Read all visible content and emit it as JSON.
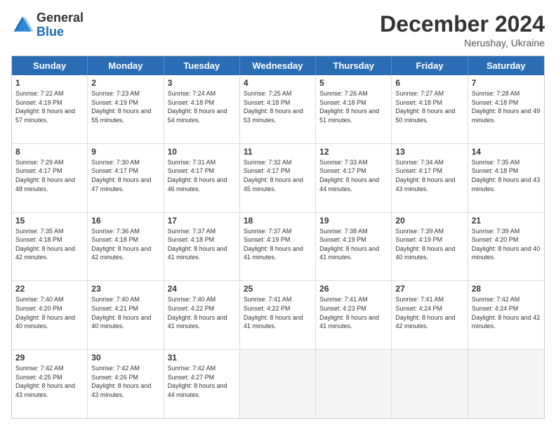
{
  "header": {
    "logo_general": "General",
    "logo_blue": "Blue",
    "month_title": "December 2024",
    "subtitle": "Nerushay, Ukraine"
  },
  "days_of_week": [
    "Sunday",
    "Monday",
    "Tuesday",
    "Wednesday",
    "Thursday",
    "Friday",
    "Saturday"
  ],
  "weeks": [
    [
      {
        "num": "1",
        "sunrise": "7:22 AM",
        "sunset": "4:19 PM",
        "daylight": "8 hours and 57 minutes."
      },
      {
        "num": "2",
        "sunrise": "7:23 AM",
        "sunset": "4:19 PM",
        "daylight": "8 hours and 55 minutes."
      },
      {
        "num": "3",
        "sunrise": "7:24 AM",
        "sunset": "4:18 PM",
        "daylight": "8 hours and 54 minutes."
      },
      {
        "num": "4",
        "sunrise": "7:25 AM",
        "sunset": "4:18 PM",
        "daylight": "8 hours and 53 minutes."
      },
      {
        "num": "5",
        "sunrise": "7:26 AM",
        "sunset": "4:18 PM",
        "daylight": "8 hours and 51 minutes."
      },
      {
        "num": "6",
        "sunrise": "7:27 AM",
        "sunset": "4:18 PM",
        "daylight": "8 hours and 50 minutes."
      },
      {
        "num": "7",
        "sunrise": "7:28 AM",
        "sunset": "4:18 PM",
        "daylight": "8 hours and 49 minutes."
      }
    ],
    [
      {
        "num": "8",
        "sunrise": "7:29 AM",
        "sunset": "4:17 PM",
        "daylight": "8 hours and 48 minutes."
      },
      {
        "num": "9",
        "sunrise": "7:30 AM",
        "sunset": "4:17 PM",
        "daylight": "8 hours and 47 minutes."
      },
      {
        "num": "10",
        "sunrise": "7:31 AM",
        "sunset": "4:17 PM",
        "daylight": "8 hours and 46 minutes."
      },
      {
        "num": "11",
        "sunrise": "7:32 AM",
        "sunset": "4:17 PM",
        "daylight": "8 hours and 45 minutes."
      },
      {
        "num": "12",
        "sunrise": "7:33 AM",
        "sunset": "4:17 PM",
        "daylight": "8 hours and 44 minutes."
      },
      {
        "num": "13",
        "sunrise": "7:34 AM",
        "sunset": "4:17 PM",
        "daylight": "8 hours and 43 minutes."
      },
      {
        "num": "14",
        "sunrise": "7:35 AM",
        "sunset": "4:18 PM",
        "daylight": "8 hours and 43 minutes."
      }
    ],
    [
      {
        "num": "15",
        "sunrise": "7:35 AM",
        "sunset": "4:18 PM",
        "daylight": "8 hours and 42 minutes."
      },
      {
        "num": "16",
        "sunrise": "7:36 AM",
        "sunset": "4:18 PM",
        "daylight": "8 hours and 42 minutes."
      },
      {
        "num": "17",
        "sunrise": "7:37 AM",
        "sunset": "4:18 PM",
        "daylight": "8 hours and 41 minutes."
      },
      {
        "num": "18",
        "sunrise": "7:37 AM",
        "sunset": "4:19 PM",
        "daylight": "8 hours and 41 minutes."
      },
      {
        "num": "19",
        "sunrise": "7:38 AM",
        "sunset": "4:19 PM",
        "daylight": "8 hours and 41 minutes."
      },
      {
        "num": "20",
        "sunrise": "7:39 AM",
        "sunset": "4:19 PM",
        "daylight": "8 hours and 40 minutes."
      },
      {
        "num": "21",
        "sunrise": "7:39 AM",
        "sunset": "4:20 PM",
        "daylight": "8 hours and 40 minutes."
      }
    ],
    [
      {
        "num": "22",
        "sunrise": "7:40 AM",
        "sunset": "4:20 PM",
        "daylight": "8 hours and 40 minutes."
      },
      {
        "num": "23",
        "sunrise": "7:40 AM",
        "sunset": "4:21 PM",
        "daylight": "8 hours and 40 minutes."
      },
      {
        "num": "24",
        "sunrise": "7:40 AM",
        "sunset": "4:22 PM",
        "daylight": "8 hours and 41 minutes."
      },
      {
        "num": "25",
        "sunrise": "7:41 AM",
        "sunset": "4:22 PM",
        "daylight": "8 hours and 41 minutes."
      },
      {
        "num": "26",
        "sunrise": "7:41 AM",
        "sunset": "4:23 PM",
        "daylight": "8 hours and 41 minutes."
      },
      {
        "num": "27",
        "sunrise": "7:41 AM",
        "sunset": "4:24 PM",
        "daylight": "8 hours and 42 minutes."
      },
      {
        "num": "28",
        "sunrise": "7:42 AM",
        "sunset": "4:24 PM",
        "daylight": "8 hours and 42 minutes."
      }
    ],
    [
      {
        "num": "29",
        "sunrise": "7:42 AM",
        "sunset": "4:25 PM",
        "daylight": "8 hours and 43 minutes."
      },
      {
        "num": "30",
        "sunrise": "7:42 AM",
        "sunset": "4:26 PM",
        "daylight": "8 hours and 43 minutes."
      },
      {
        "num": "31",
        "sunrise": "7:42 AM",
        "sunset": "4:27 PM",
        "daylight": "8 hours and 44 minutes."
      },
      null,
      null,
      null,
      null
    ]
  ]
}
